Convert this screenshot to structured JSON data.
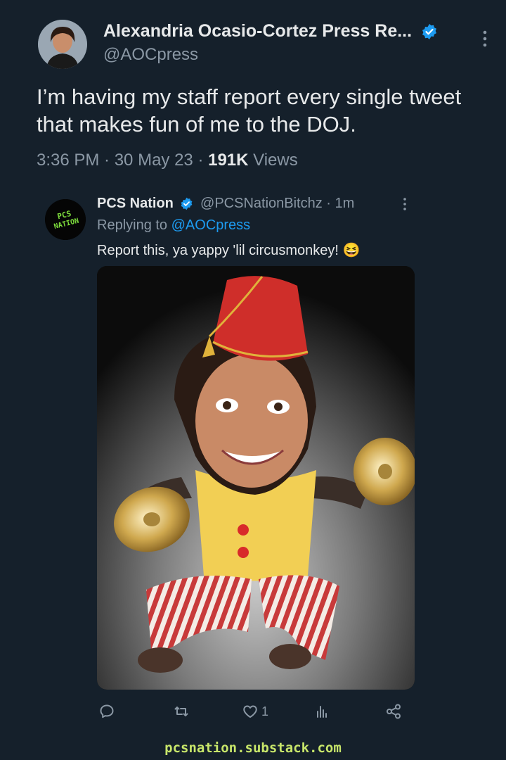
{
  "main_tweet": {
    "author_name": "Alexandria Ocasio-Cortez Press Re...",
    "handle": "@AOCpress",
    "text": "I’m having my staff report every single tweet that makes fun of me to the DOJ.",
    "time": "3:36 PM · 30 May 23 · ",
    "views_count": "191K",
    "views_label": " Views"
  },
  "reply": {
    "author_name": "PCS Nation",
    "handle_time": "@PCSNationBitchz · 1m",
    "replying_prefix": "Replying to ",
    "replying_to": "@AOCpress",
    "text": "Report this, ya yappy 'lil circusmonkey! 😆",
    "avatar_text_line1": "PCS",
    "avatar_text_line2": "NATION",
    "media_alt_icon": "meme-image"
  },
  "actions": {
    "reply_icon": "reply-icon",
    "retweet_icon": "retweet-icon",
    "like_icon": "heart-icon",
    "like_count": "1",
    "views_icon": "analytics-icon",
    "share_icon": "share-icon"
  },
  "footer": {
    "text": "pcsnation.substack.com"
  },
  "colors": {
    "background": "#15202b",
    "text": "#e7e9ea",
    "secondary": "#8b98a5",
    "accent": "#1d9bf0",
    "footer": "#c8e66a"
  }
}
